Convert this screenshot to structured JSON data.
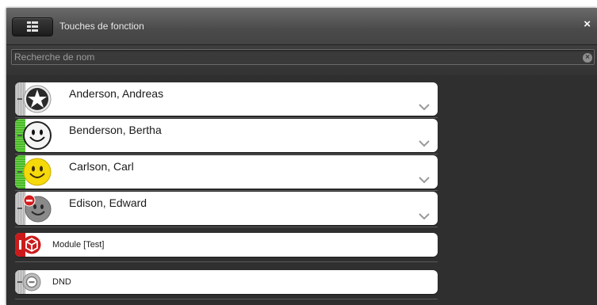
{
  "window": {
    "title": "Touches de fonction",
    "close_glyph": "×"
  },
  "search": {
    "placeholder": "Recherche de nom",
    "value": "",
    "clear_glyph": "×"
  },
  "contacts": [
    {
      "name": "Anderson, Andreas",
      "status": "offline",
      "icon": "star-avatar-icon",
      "bar_color": "#a9a9a9"
    },
    {
      "name": "Benderson, Bertha",
      "status": "available",
      "icon": "white-smiley-icon",
      "bar_color": "#49b928"
    },
    {
      "name": "Carlson, Carl",
      "status": "available",
      "icon": "yellow-smiley-icon",
      "bar_color": "#49b928"
    },
    {
      "name": "Edison, Edward",
      "status": "do-not-disturb",
      "icon": "grey-smiley-dnd-icon",
      "bar_color": "#a9a9a9"
    }
  ],
  "modules": [
    {
      "name": "Module [Test]",
      "icon": "module-cube-icon",
      "bar_color": "#cc1a1a"
    },
    {
      "name": "DND",
      "icon": "dnd-icon",
      "bar_color": "#a9a9a9"
    }
  ],
  "colors": {
    "background": "#2f2f2f",
    "titlebar": "#555555",
    "card": "#ffffff",
    "accent_green": "#49b928",
    "accent_red": "#cc1a1a"
  }
}
